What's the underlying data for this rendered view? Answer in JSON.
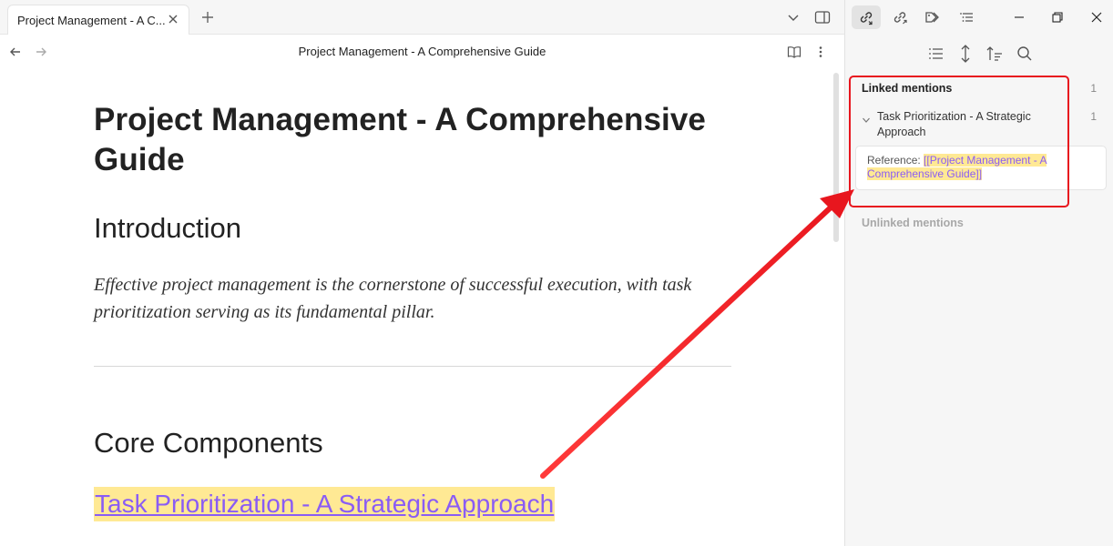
{
  "tab": {
    "label": "Project Management - A C...",
    "close_icon": "close-icon",
    "new_tab_icon": "plus-icon"
  },
  "tabbar_right": {
    "list_icon": "chevron-down-icon",
    "sidebar_icon": "sidebar-toggle-icon"
  },
  "nav": {
    "back_icon": "arrow-left-icon",
    "forward_icon": "arrow-right-icon",
    "title": "Project Management - A Comprehensive Guide",
    "reading_icon": "book-open-icon",
    "more_icon": "more-vertical-icon"
  },
  "document": {
    "title": "Project Management - A Comprehensive Guide",
    "heading_intro": "Introduction",
    "intro_text": "Effective project management is the cornerstone of successful execution, with task prioritization serving as its fundamental pillar.",
    "heading_core": "Core Components",
    "link_text": "Task Prioritization - A Strategic Approach"
  },
  "sidebar": {
    "tabs": [
      {
        "icon": "backlinks-icon",
        "active": true
      },
      {
        "icon": "outgoing-links-icon",
        "active": false
      },
      {
        "icon": "tags-icon",
        "active": false
      },
      {
        "icon": "outline-icon",
        "active": false
      }
    ],
    "window": {
      "minimize_icon": "minimize-icon",
      "restore_icon": "restore-icon",
      "close_icon": "close-icon"
    },
    "tools": [
      "list-icon",
      "expand-collapse-icon",
      "sort-icon",
      "search-icon"
    ],
    "linked_mentions": {
      "header": "Linked mentions",
      "count": "1",
      "item": {
        "title": "Task Prioritization - A Strategic Approach",
        "count": "1",
        "context_prefix": "Reference: ",
        "context_link": "[[Project Management - A Comprehensive Guide]]"
      }
    },
    "unlinked_mentions": {
      "header": "Unlinked mentions"
    }
  },
  "colors": {
    "accent": "#8a5cf5",
    "highlight": "#ffe994",
    "annotation": "#e8161e"
  }
}
